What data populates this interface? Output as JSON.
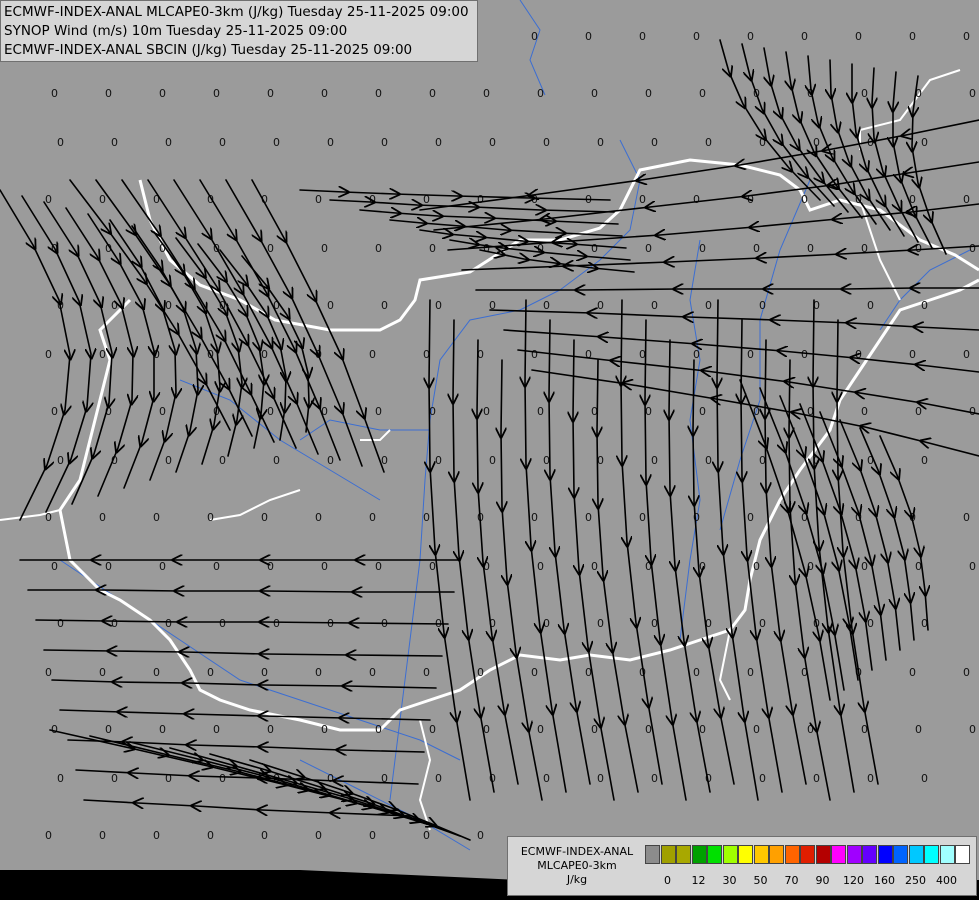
{
  "header": {
    "lines": [
      "ECMWF-INDEX-ANAL MLCAPE0-3km (J/kg) Tuesday 25-11-2025 09:00",
      "SYNOP Wind (m/s) 10m Tuesday 25-11-2025 09:00",
      "ECMWF-INDEX-ANAL SBCIN (J/kg) Tuesday 25-11-2025 09:00"
    ]
  },
  "map": {
    "background_color": "#9b9b9b",
    "border_color": "#ffffff",
    "river_color": "#3c6ed2",
    "streamline_color": "#000000",
    "sbcin_value_label": "0"
  },
  "legend": {
    "title_lines": [
      "ECMWF-INDEX-ANAL",
      "MLCAPE0-3km",
      "J/kg"
    ],
    "swatch_colors": [
      "#8c8c8c",
      "#a0a000",
      "#a8a800",
      "#00a000",
      "#00e000",
      "#a0ff00",
      "#ffff00",
      "#ffc800",
      "#ffa000",
      "#ff6400",
      "#e01e00",
      "#b40000",
      "#ff00ff",
      "#a000ff",
      "#6400ff",
      "#0000ff",
      "#0064ff",
      "#00c8ff",
      "#00ffff",
      "#a0ffff",
      "#ffffff"
    ],
    "tick_labels": [
      "0",
      "12",
      "30",
      "50",
      "70",
      "90",
      "120",
      "160",
      "250",
      "400"
    ]
  }
}
